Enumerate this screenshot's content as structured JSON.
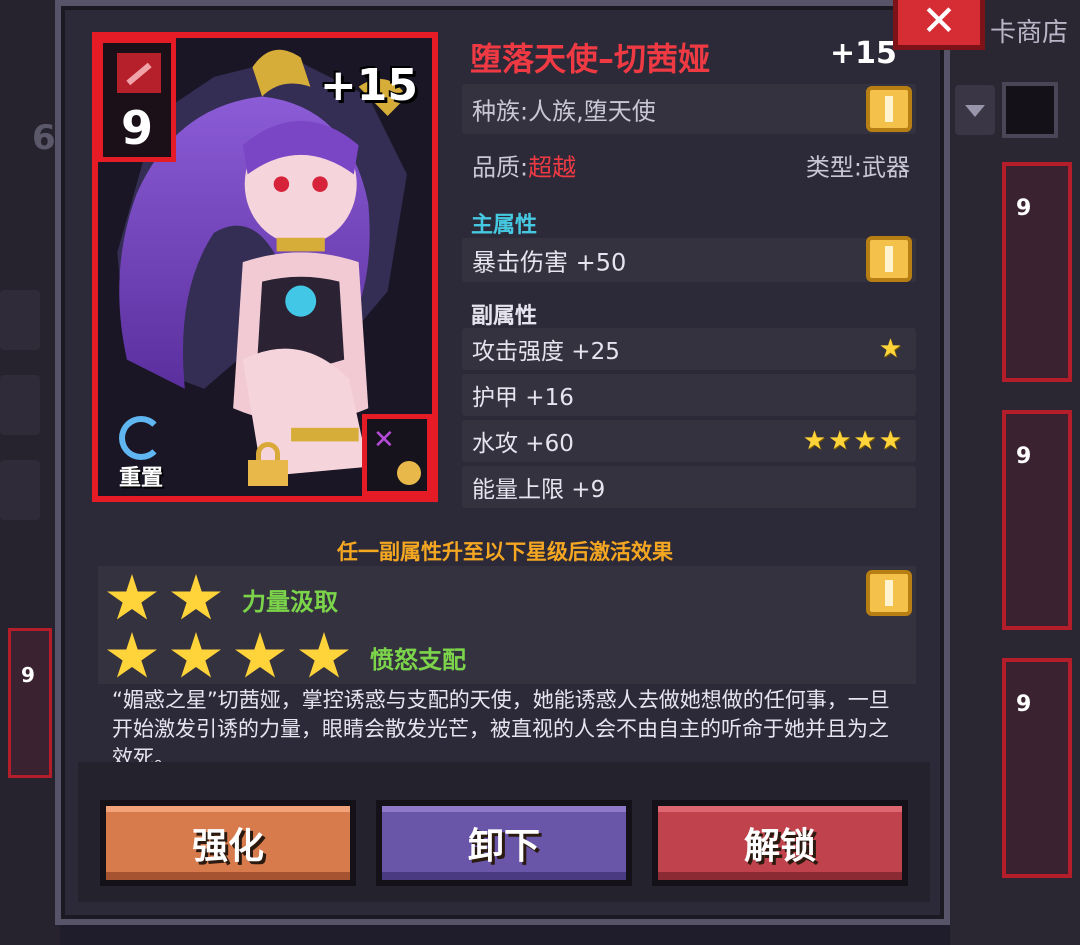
{
  "background": {
    "shop_label": "卡商店",
    "left_number": "6",
    "card_levels": [
      "9",
      "9",
      "9"
    ],
    "left_card_level": "9"
  },
  "item": {
    "level": "9",
    "enhance_plus": "+15",
    "name": "堕落天使–切茜娅",
    "name_plus": "+15",
    "race": "种族:人族,堕天使",
    "quality_label": "品质:",
    "quality_value": "超越",
    "type": "类型:武器",
    "reset_label": "重置"
  },
  "main_attr": {
    "heading": "主属性",
    "stat": "暴击伤害 +50"
  },
  "sub_attr": {
    "heading": "副属性",
    "stats": [
      {
        "label": "攻击强度 +25",
        "stars": "★"
      },
      {
        "label": "护甲 +16",
        "stars": ""
      },
      {
        "label": "水攻 +60",
        "stars": "★★★★"
      },
      {
        "label": "能量上限 +9",
        "stars": ""
      }
    ]
  },
  "set_effect": {
    "heading": "任一副属性升至以下星级后激活效果",
    "effects": [
      {
        "name": "力量汲取",
        "stars": 2
      },
      {
        "name": "愤怒支配",
        "stars": 4
      }
    ]
  },
  "description": "“媚惑之星”切茜娅，掌控诱惑与支配的天使，她能诱惑人去做她想做的任何事，一旦开始激发引诱的力量，眼睛会散发光芒，被直视的人会不由自主的听命于她并且为之效死。",
  "buttons": {
    "enhance": "强化",
    "unequip": "卸下",
    "unlock": "解锁"
  },
  "colors": {
    "quality": "#ef3a44",
    "main_heading": "#46c9e0",
    "effect_heading": "#f5a722",
    "effect_name": "#7bd44a",
    "star": "#ffd43a"
  }
}
